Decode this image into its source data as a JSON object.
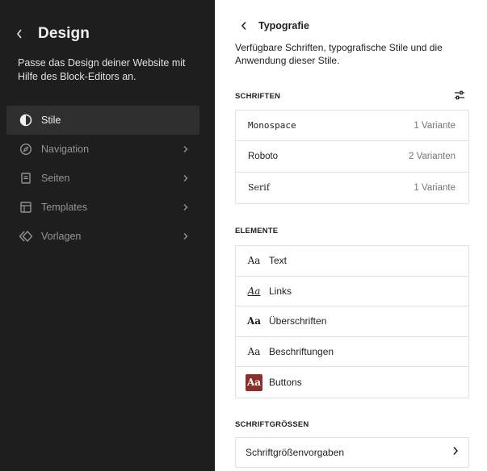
{
  "sidebar": {
    "title": "Design",
    "description": "Passe das Design deiner Website mit Hilfe des Block-Editors an.",
    "items": [
      {
        "label": "Stile",
        "icon": "half-circle-icon",
        "active": true
      },
      {
        "label": "Navigation",
        "icon": "compass-icon"
      },
      {
        "label": "Seiten",
        "icon": "page-icon"
      },
      {
        "label": "Templates",
        "icon": "layout-icon"
      },
      {
        "label": "Vorlagen",
        "icon": "pattern-icon"
      }
    ]
  },
  "panel": {
    "title": "Typografie",
    "description": "Verfügbare Schriften, typografische Stile und die Anwendung dieser Stile.",
    "fonts_section": {
      "label": "SCHRIFTEN",
      "fonts": [
        {
          "name": "Monospace",
          "variants": "1 Variante"
        },
        {
          "name": "Roboto",
          "variants": "2 Varianten"
        },
        {
          "name": "Serif",
          "variants": "1 Variante"
        }
      ]
    },
    "elements_section": {
      "label": "ELEMENTE",
      "elements": [
        {
          "label": "Text",
          "sample": "Aa"
        },
        {
          "label": "Links",
          "sample": "Aa"
        },
        {
          "label": "Überschriften",
          "sample": "Aa"
        },
        {
          "label": "Beschriftungen",
          "sample": "Aa"
        },
        {
          "label": "Buttons",
          "sample": "Aa"
        }
      ]
    },
    "sizes_section": {
      "label": "SCHRIFTGRÖSSEN",
      "item": "Schriftgrößenvorgaben"
    }
  },
  "colors": {
    "sidebar_bg": "#1e1e1e",
    "sidebar_active_bg": "#2f2f2f",
    "button_sample_bg": "#8c2f2b",
    "border": "#e0e0e0",
    "muted_text": "#757575"
  }
}
